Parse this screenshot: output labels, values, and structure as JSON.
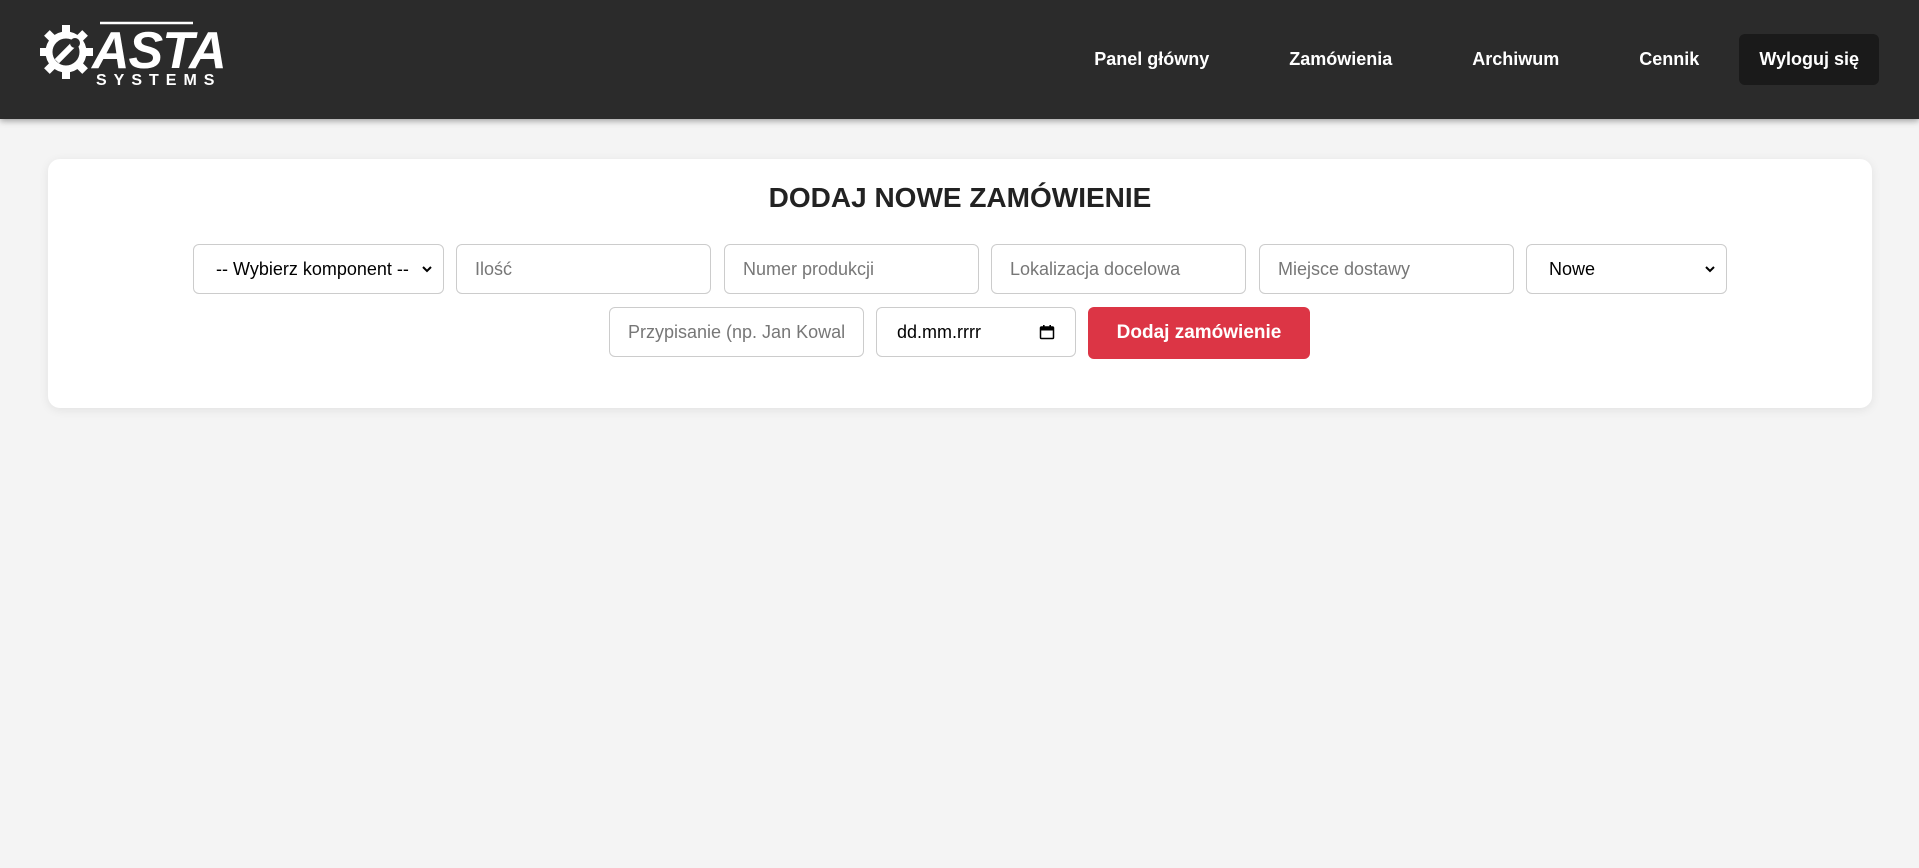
{
  "brand": {
    "logo_text": "ASTA",
    "logo_subtext": "SYSTEMS"
  },
  "nav": {
    "items": [
      {
        "label": "Panel główny"
      },
      {
        "label": "Zamówienia"
      },
      {
        "label": "Archiwum"
      },
      {
        "label": "Cennik"
      }
    ],
    "logout_label": "Wyloguj się"
  },
  "form": {
    "title": "DODAJ NOWE ZAMÓWIENIE",
    "component_select": {
      "value": "-- Wybierz komponent --"
    },
    "quantity": {
      "placeholder": "Ilość",
      "value": ""
    },
    "production_number": {
      "placeholder": "Numer produkcji",
      "value": ""
    },
    "target_location": {
      "placeholder": "Lokalizacja docelowa",
      "value": ""
    },
    "delivery_place": {
      "placeholder": "Miejsce dostawy",
      "value": ""
    },
    "status_select": {
      "value": "Nowe"
    },
    "assignment": {
      "placeholder": "Przypisanie (np. Jan Kowalski)",
      "value": ""
    },
    "date": {
      "value": "dd.mm.rrrr"
    },
    "submit_label": "Dodaj zamówienie"
  },
  "colors": {
    "header_bg": "#2b2b2b",
    "page_bg": "#f4f4f4",
    "accent": "#dc3545"
  },
  "icons": {
    "logo": "gear-wrench-icon",
    "select_arrow": "chevron-down-icon",
    "calendar": "calendar-icon"
  }
}
